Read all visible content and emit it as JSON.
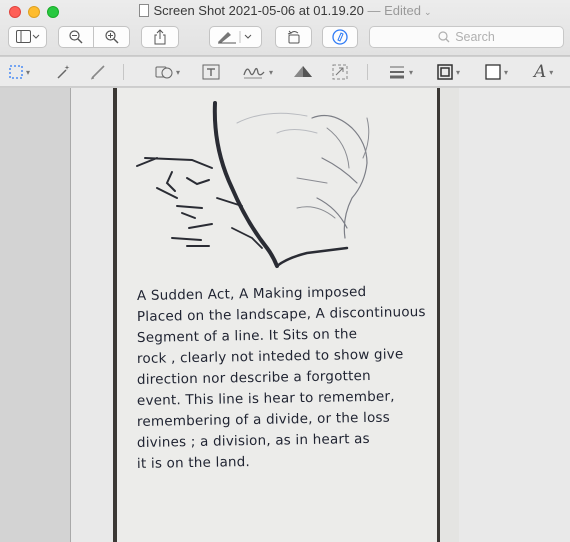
{
  "window": {
    "title": "Screen Shot 2021-05-06 at 01.19.20",
    "edited_label": "— Edited"
  },
  "toolbar": {
    "search_placeholder": "Search"
  },
  "note": {
    "lines": [
      "A Sudden Act, A Making imposed",
      "Placed on the landscape, A discontinuous",
      "Segment of a line. It Sits on the",
      "rock , clearly not inteded to show give",
      "direction nor describe a forgotten",
      "event. This line is hear to remember,",
      "remembering of a divide, or the loss",
      "divines ; a division, as in heart as",
      "it is on the land."
    ]
  },
  "icons": {
    "sidebar": "sidebar-icon",
    "zoom_out": "zoom-out-icon",
    "zoom_in": "zoom-in-icon",
    "share": "share-icon",
    "highlight": "highlighter-icon",
    "rotate": "rotate-icon",
    "markup": "markup-pen-icon",
    "search": "search-icon"
  },
  "colors": {
    "close": "#fe5f57",
    "minimize": "#febc2e",
    "maximize": "#28c840",
    "accent": "#2f7bf5",
    "ink": "#1f2331"
  }
}
